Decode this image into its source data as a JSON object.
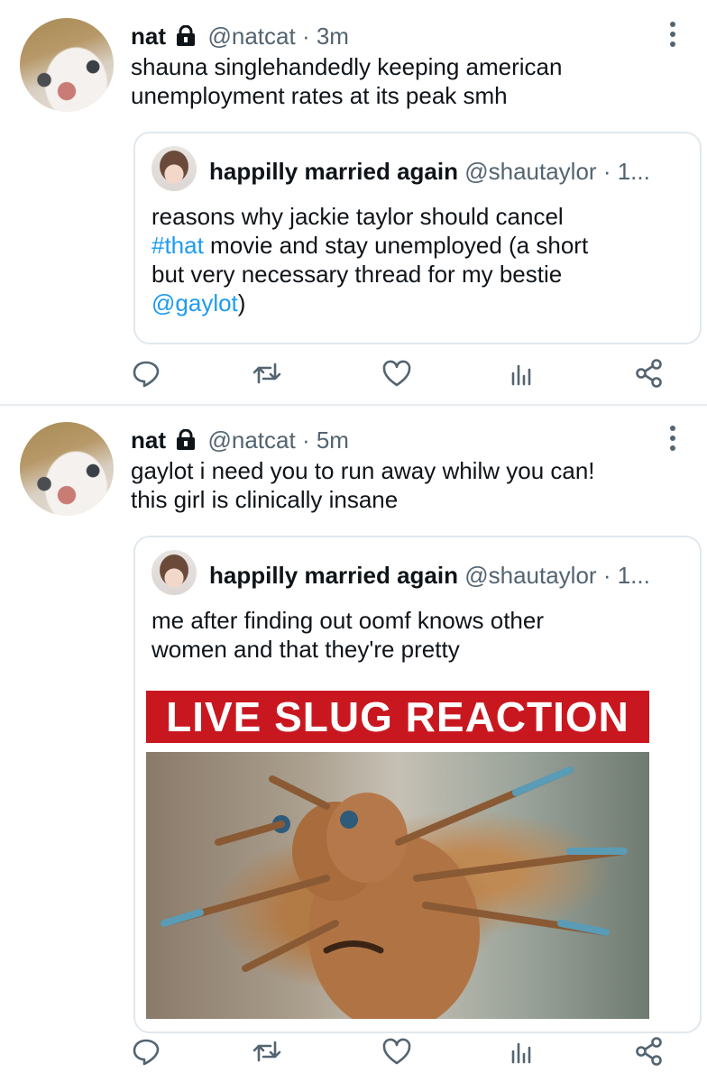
{
  "tweets": [
    {
      "name": "nat",
      "handle": "@natcat",
      "sep": "·",
      "time": "3m",
      "text_line1": "shauna singlehandedly keeping american",
      "text_line2": "unemployment rates at its peak smh",
      "quote": {
        "name": "happilly married again",
        "handle": "@shautaylor",
        "sep": "·",
        "time": "1...",
        "line1": "reasons why jackie taylor should cancel",
        "line2_link": "#that",
        "line2_rest": " movie and stay unemployed (a short",
        "line3": "but very necessary thread for my bestie",
        "line4_link": "@gaylot",
        "line4_rest": ")"
      }
    },
    {
      "name": "nat",
      "handle": "@natcat",
      "sep": "·",
      "time": "5m",
      "text_line1": "gaylot i need you to run away whilw you can!",
      "text_line2": "this girl is clinically insane",
      "quote": {
        "name": "happilly married again",
        "handle": "@shautaylor",
        "sep": "·",
        "time": "1...",
        "line1": "me after finding out oomf knows other",
        "line2": "women and that they're pretty",
        "image_caption": "LIVE SLUG REACTION"
      }
    }
  ],
  "icons": [
    "reply-icon",
    "retweet-icon",
    "like-icon",
    "analytics-icon",
    "share-icon",
    "lock-icon",
    "more-icon"
  ],
  "colors": {
    "link": "#1d9bf0",
    "secondary": "#536471",
    "banner": "#c9171f",
    "divider": "#e6ecf0"
  }
}
